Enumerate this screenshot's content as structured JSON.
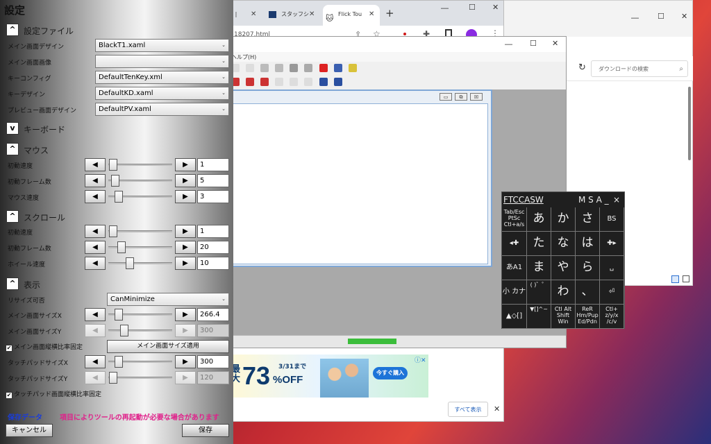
{
  "explorer": {
    "search_placeholder": "ダウンロードの検索"
  },
  "browser": {
    "tabs": [
      {
        "label": "E |"
      },
      {
        "label": "スタッフシ"
      },
      {
        "label": "Flick Tou"
      }
    ],
    "url_fragment": "18207.html",
    "ad": {
      "big_number": "73",
      "percent_off": "%OFF",
      "prefix": "最大",
      "date": "3/31まで",
      "cta": "今すぐ購入"
    },
    "see_all": "すべて表示"
  },
  "editor": {
    "menu_help": "ヘルプ(H)"
  },
  "keyboard": {
    "header_left": "FTCCASW",
    "header_right": "M S A _",
    "close": "×",
    "rows": [
      [
        "Tab/Esc PtSc Ctl+a/s",
        "あ",
        "か",
        "さ",
        "BS"
      ],
      [
        "◂✚",
        "た",
        "な",
        "は",
        "✚▸"
      ],
      [
        "あA1",
        "ま",
        "や",
        "ら",
        "␣"
      ],
      [
        "小 カナ",
        "( )゛゜",
        "わ",
        "、",
        "⏎"
      ],
      [
        "▲◇[]",
        "▼[]^~",
        "Ctl Alt Shift Win",
        "ReR Hm/Pup Ed/Pdn",
        "Ctl+ z/y/x /c/v"
      ]
    ]
  },
  "settings": {
    "title": "設定",
    "sections": {
      "file": "設定ファイル",
      "keyboard": "キーボード",
      "mouse": "マウス",
      "scroll": "スクロール",
      "display": "表示"
    },
    "file_rows": [
      {
        "label": "メイン画面デザイン",
        "value": "BlackT1.xaml"
      },
      {
        "label": "メイン画面画像",
        "value": ""
      },
      {
        "label": "キーコンフィグ",
        "value": "DefaultTenKey.xml"
      },
      {
        "label": "キーデザイン",
        "value": "DefaultKD.xaml"
      },
      {
        "label": "プレビュー画面デザイン",
        "value": "DefaultPV.xaml"
      }
    ],
    "mouse_rows": [
      {
        "label": "初動速度",
        "value": "1",
        "level": 0.0
      },
      {
        "label": "初動フレーム数",
        "value": "5",
        "level": 0.04
      },
      {
        "label": "マウス速度",
        "value": "3",
        "level": 0.1
      }
    ],
    "scroll_rows": [
      {
        "label": "初動速度",
        "value": "1",
        "level": 0.0
      },
      {
        "label": "初動フレーム数",
        "value": "20",
        "level": 0.15
      },
      {
        "label": "ホイール速度",
        "value": "10",
        "level": 0.3
      }
    ],
    "resize_label": "リサイズ可否",
    "resize_value": "CanMinimize",
    "display_rows": [
      {
        "label": "メイン画面サイズX",
        "value": "266.4",
        "level": 0.1
      },
      {
        "label": "メイン画面サイズY",
        "value": "300",
        "level": 0.2
      }
    ],
    "keep_ratio_main": "メイン画面縦横比率固定",
    "apply_main_size": "メイン画面サイズ適用",
    "touchpad_rows": [
      {
        "label": "タッチパッドサイズX",
        "value": "300",
        "level": 0.1
      },
      {
        "label": "タッチパッドサイズY",
        "value": "120",
        "level": 0.0
      }
    ],
    "keep_ratio_touchpad": "タッチパッド画面縦横比率固定",
    "save_data": "保存データ",
    "warning": "項目によりツールの再起動が必要な場合があります",
    "cancel": "キャンセル",
    "save": "保存",
    "arrow_left": "◀",
    "arrow_right": "▶",
    "collapse": "^",
    "expand": "v",
    "check": "✔"
  },
  "colors": {
    "save_data": "#1a3cd8",
    "warning": "#e0208a"
  }
}
